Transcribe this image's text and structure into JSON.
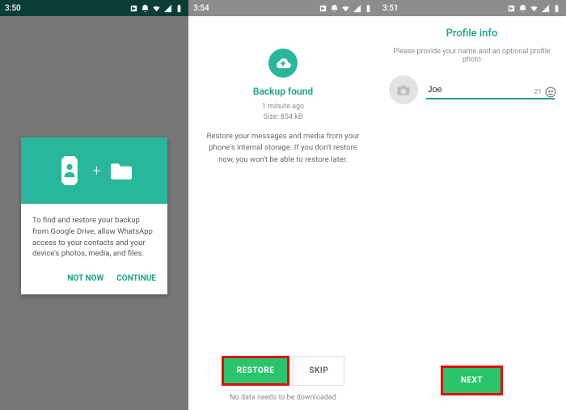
{
  "screen1": {
    "time": "3:50",
    "card_text": "To find and restore your backup from Google Drive, allow WhatsApp access to your contacts and your device's photos, media, and files.",
    "not_now": "NOT NOW",
    "continue": "CONTINUE"
  },
  "screen2": {
    "time": "3:54",
    "title": "Backup found",
    "meta1": "1 minute ago",
    "meta2": "Size: 854 kB",
    "desc": "Restore your messages and media from your phone's internal storage. If you don't restore now, you won't be able to restore later.",
    "restore": "RESTORE",
    "skip": "SKIP",
    "note": "No data needs to be downloaded"
  },
  "screen3": {
    "time": "3:51",
    "title": "Profile info",
    "desc": "Please provide your name and an optional profile photo",
    "name_value": "Joe",
    "char_count": "21",
    "next": "NEXT"
  }
}
